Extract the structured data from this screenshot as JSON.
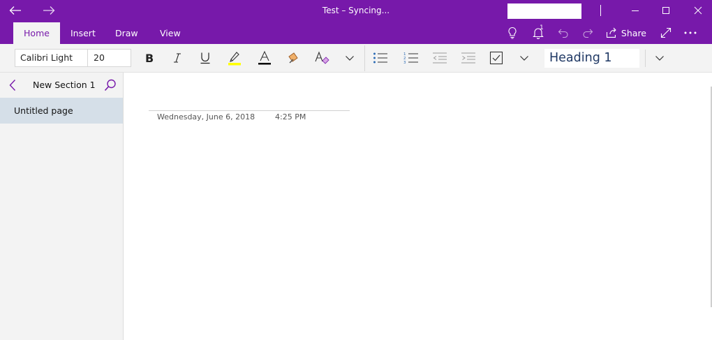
{
  "window": {
    "title": "Test – Syncing...",
    "accent_color": "#7719aa"
  },
  "ribbon": {
    "tabs": [
      {
        "label": "Home",
        "active": true
      },
      {
        "label": "Insert",
        "active": false
      },
      {
        "label": "Draw",
        "active": false
      },
      {
        "label": "View",
        "active": false
      }
    ],
    "notification_count": "1",
    "share_label": "Share"
  },
  "toolbar": {
    "font_name": "Calibri Light",
    "font_size": "20",
    "style": "Heading 1",
    "highlight_color": "#ffff00",
    "font_color": "#000000"
  },
  "sidebar": {
    "section_title": "New Section 1",
    "pages": [
      {
        "label": "Untitled page",
        "selected": true
      }
    ]
  },
  "page": {
    "date": "Wednesday, June 6, 2018",
    "time": "4:25 PM"
  },
  "icons": [
    "back-arrow-icon",
    "forward-arrow-icon",
    "minimize-icon",
    "maximize-icon",
    "close-icon",
    "lightbulb-icon",
    "bell-icon",
    "undo-icon",
    "redo-icon",
    "share-icon",
    "expand-icon",
    "more-icon",
    "bold-icon",
    "italic-icon",
    "underline-icon",
    "highlighter-icon",
    "font-color-icon",
    "format-painter-icon",
    "clear-formatting-icon",
    "chevron-down-icon",
    "bullet-list-icon",
    "numbered-list-icon",
    "outdent-icon",
    "indent-icon",
    "checkbox-icon",
    "chevron-left-icon",
    "search-icon"
  ]
}
